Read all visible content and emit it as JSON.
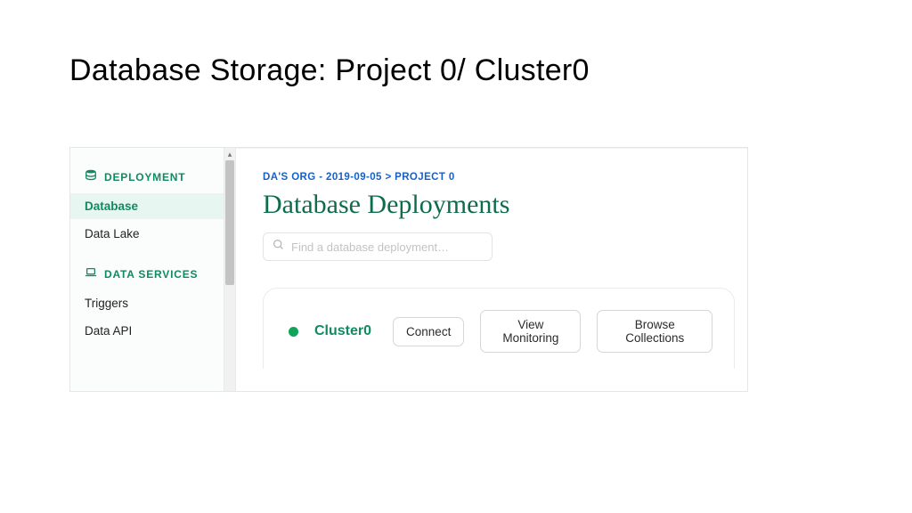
{
  "slide_title": "Database Storage: Project 0/ Cluster0",
  "sidebar": {
    "sections": [
      {
        "label": "DEPLOYMENT",
        "icon": "database-stack-icon",
        "items": [
          {
            "label": "Database",
            "active": true
          },
          {
            "label": "Data Lake",
            "active": false
          }
        ]
      },
      {
        "label": "DATA SERVICES",
        "icon": "laptop-icon",
        "items": [
          {
            "label": "Triggers",
            "active": false
          },
          {
            "label": "Data API",
            "active": false
          }
        ]
      }
    ]
  },
  "breadcrumb": "DA'S ORG - 2019-09-05 > PROJECT 0",
  "page_heading": "Database Deployments",
  "search": {
    "placeholder": "Find a database deployment…"
  },
  "cluster": {
    "name": "Cluster0",
    "status_color": "#10a35a",
    "buttons": [
      "Connect",
      "View Monitoring",
      "Browse Collections"
    ]
  }
}
